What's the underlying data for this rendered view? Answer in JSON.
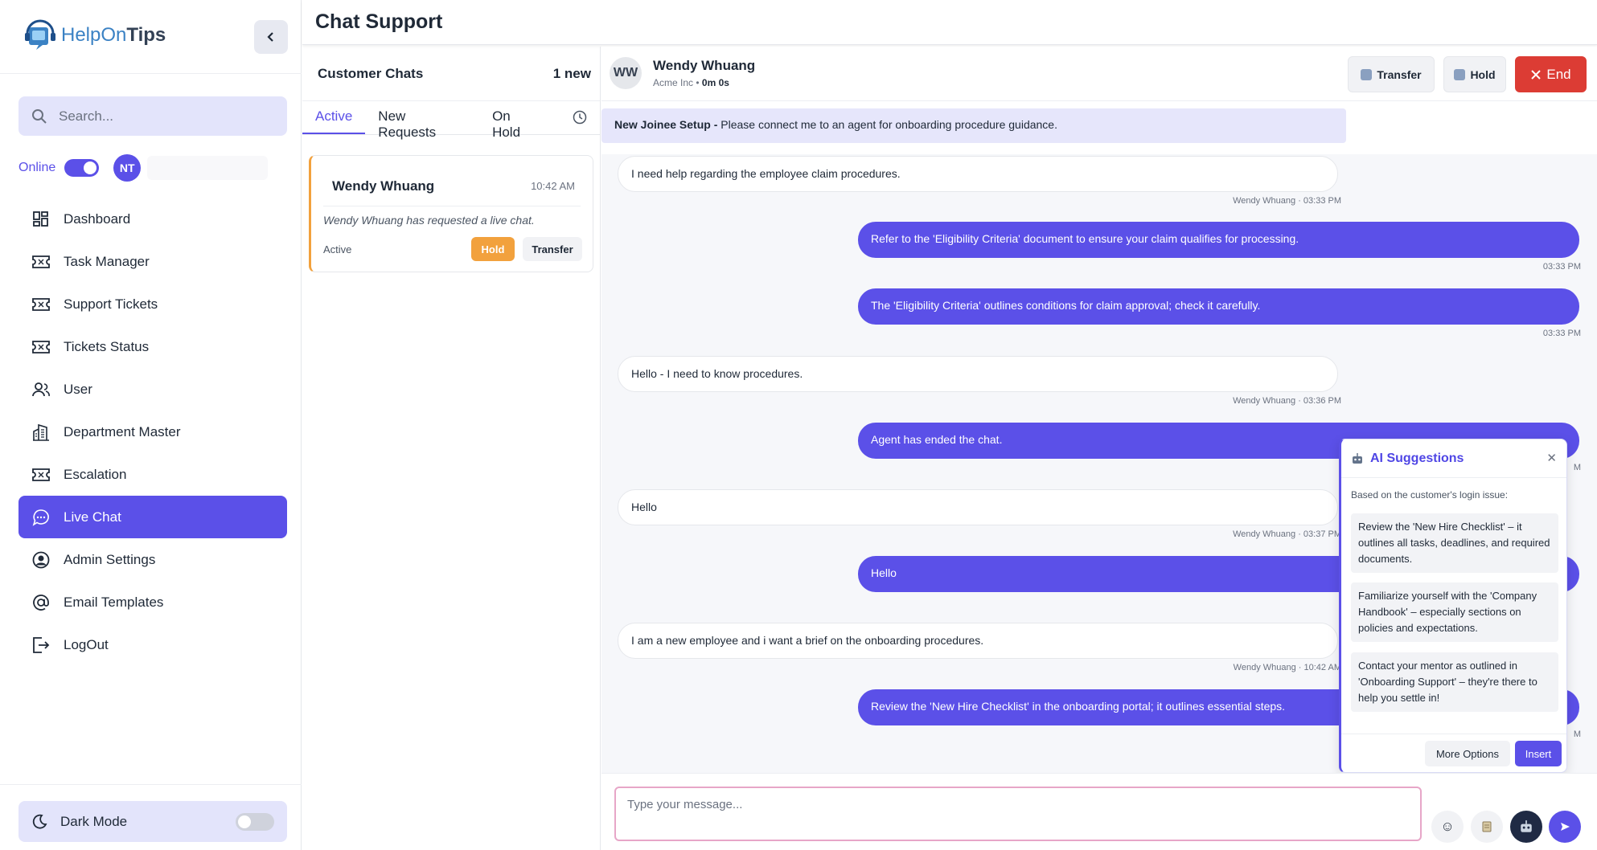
{
  "brand": {
    "name_light": "HelpOn",
    "name_bold": "Tips"
  },
  "sidebar": {
    "search_placeholder": "Search...",
    "online_label": "Online",
    "agent_initials": "NT",
    "items": [
      {
        "label": "Dashboard",
        "icon": "dashboard-icon"
      },
      {
        "label": "Task Manager",
        "icon": "ticket-icon"
      },
      {
        "label": "Support Tickets",
        "icon": "ticket-icon"
      },
      {
        "label": "Tickets Status",
        "icon": "ticket-icon"
      },
      {
        "label": "User",
        "icon": "users-icon"
      },
      {
        "label": "Department Master",
        "icon": "building-icon"
      },
      {
        "label": "Escalation",
        "icon": "ticket-icon"
      },
      {
        "label": "Live Chat",
        "icon": "chat-bubble-icon"
      },
      {
        "label": "Admin Settings",
        "icon": "user-circle-icon"
      },
      {
        "label": "Email Templates",
        "icon": "at-sign-icon"
      },
      {
        "label": "LogOut",
        "icon": "logout-icon"
      }
    ],
    "dark_mode_label": "Dark Mode"
  },
  "header": {
    "title": "Chat Support"
  },
  "chat_list": {
    "title": "Customer Chats",
    "new_count": "1 new",
    "tabs": [
      "Active",
      "New Requests",
      "On Hold"
    ],
    "card": {
      "name": "Wendy Whuang",
      "time": "10:42 AM",
      "message": "Wendy Whuang has requested a live chat.",
      "status": "Active",
      "hold_label": "Hold",
      "transfer_label": "Transfer"
    }
  },
  "conversation": {
    "customer": {
      "initials": "WW",
      "name": "Wendy Whuang",
      "company": "Acme Inc",
      "duration": "0m 0s"
    },
    "actions": {
      "transfer": "Transfer",
      "hold": "Hold",
      "end": "End"
    },
    "topic": {
      "title": "New Joinee Setup -",
      "text": "Please connect me to an agent for onboarding procedure guidance."
    },
    "messages": [
      {
        "from": "customer",
        "text": "I need help regarding the employee claim procedures.",
        "meta": "Wendy Whuang · 03:33 PM"
      },
      {
        "from": "agent",
        "text": "Refer to the 'Eligibility Criteria' document to ensure your claim qualifies for processing.",
        "meta": "03:33 PM"
      },
      {
        "from": "agent",
        "text": "The 'Eligibility Criteria' outlines conditions for claim approval; check it carefully.",
        "meta": "03:33 PM"
      },
      {
        "from": "customer",
        "text": "Hello - I need to know procedures.",
        "meta": "Wendy Whuang · 03:36 PM"
      },
      {
        "from": "agent",
        "text": "Agent has ended the chat.",
        "meta": "M"
      },
      {
        "from": "customer",
        "text": "Hello",
        "meta": "Wendy Whuang · 03:37 PM"
      },
      {
        "from": "agent",
        "text": "Hello",
        "meta": ""
      },
      {
        "from": "customer",
        "text": "I am a new employee and i want a brief on the onboarding procedures.",
        "meta": "Wendy Whuang · 10:42 AM"
      },
      {
        "from": "agent",
        "text": "Review the 'New Hire Checklist' in the onboarding portal; it outlines essential steps.",
        "meta": "M"
      }
    ],
    "composer_placeholder": "Type your message..."
  },
  "ai_panel": {
    "title": "AI Suggestions",
    "subtitle": "Based on the customer's login issue:",
    "suggestions": [
      "Review the 'New Hire Checklist' – it outlines all tasks, deadlines, and required documents.",
      "Familiarize yourself with the 'Company Handbook' – especially sections on policies and expectations.",
      "Contact your mentor as outlined in 'Onboarding Support' – they're there to help you settle in!"
    ],
    "more_label": "More Options",
    "insert_label": "Insert"
  },
  "colors": {
    "accent": "#5b50e8",
    "hold": "#f2a13d",
    "end": "#dc3c34"
  }
}
